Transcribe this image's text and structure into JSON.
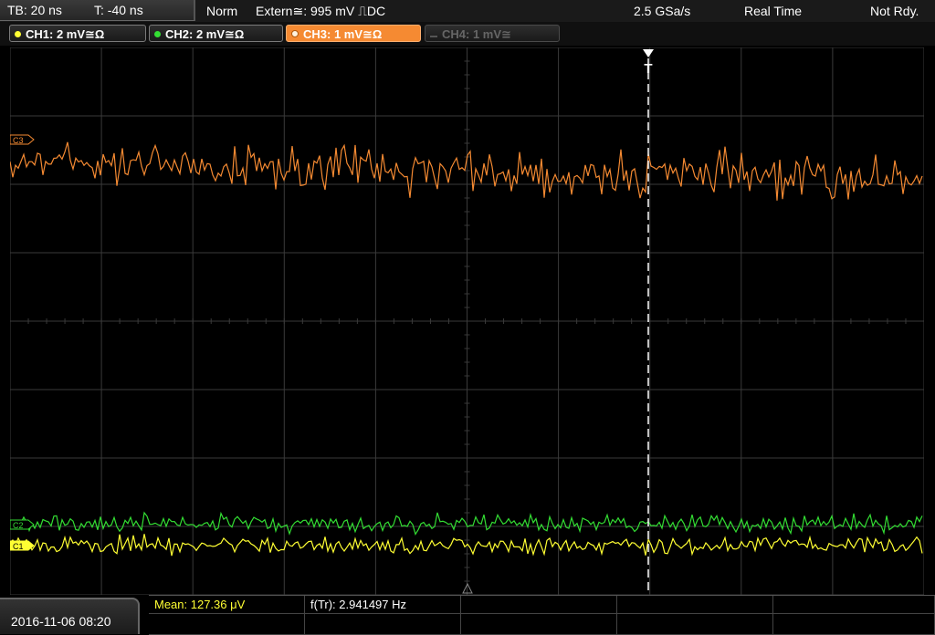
{
  "header": {
    "timebase": "TB: 20 ns",
    "trigger_time": "T: -40 ns",
    "trigger_mode": "Norm",
    "trigger_source": "Extern≅: 995 mV ⎍DC",
    "sample_rate": "2.5 GSa/s",
    "acquisition_mode": "Real Time",
    "status": "Not Rdy."
  },
  "channels": [
    {
      "label": "CH1: 2 mV≅Ω",
      "color": "#ffff33",
      "active": true
    },
    {
      "label": "CH2: 2 mV≅Ω",
      "color": "#33dd33",
      "active": true
    },
    {
      "label": "CH3: 1 mV≅Ω",
      "color": "#f58a32",
      "active": true,
      "selected": true
    },
    {
      "label": "CH4: 1 mV≅",
      "color": "#555555",
      "active": false
    }
  ],
  "waveform_markers": {
    "ch3": "C3",
    "ch2": "C2",
    "ch1": "C1",
    "trigger": "T"
  },
  "footer": {
    "datetime": "2016-11-06 08:20",
    "measurement_1": "Mean: 127.36 μV",
    "measurement_2": "f(Tr): 2.941497 Hz"
  },
  "colors": {
    "ch1": "#ffff33",
    "ch2": "#33dd33",
    "ch3": "#f58a32",
    "grid": "#3a3a3a",
    "measurement_highlight": "#ffff33"
  }
}
